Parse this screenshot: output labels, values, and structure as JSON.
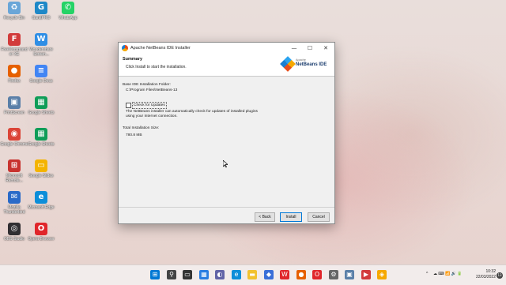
{
  "desktop": {
    "icons": [
      {
        "label": "Recycle Bin",
        "icon": "recycle-bin-icon",
        "color": "#6aa6d8",
        "glyph": "♻"
      },
      {
        "label": "GanttPRO",
        "icon": "ganttpro-icon",
        "color": "#1e88c7",
        "glyph": "G"
      },
      {
        "label": "WhatsApp",
        "icon": "whatsapp-icon",
        "color": "#25d366",
        "glyph": "✆"
      },
      {
        "label": "FreeCommander XE",
        "icon": "freecommander-icon",
        "color": "#d23b3b",
        "glyph": "F"
      },
      {
        "label": "Wondershare Screen...",
        "icon": "wondershare-icon",
        "color": "#2f8ee5",
        "glyph": "W"
      },
      {
        "label": "Firefox",
        "icon": "firefox-icon",
        "color": "#e66000",
        "glyph": "●"
      },
      {
        "label": "Google Docs",
        "icon": "google-docs-icon",
        "color": "#4285f4",
        "glyph": "≡"
      },
      {
        "label": "PrintScreen",
        "icon": "printscreen-icon",
        "color": "#5a7fa8",
        "glyph": "▣"
      },
      {
        "label": "Google Sheets",
        "icon": "google-sheets-icon",
        "color": "#0f9d58",
        "glyph": "▦"
      },
      {
        "label": "Google Chrome",
        "icon": "chrome-icon",
        "color": "#db4437",
        "glyph": "◉"
      },
      {
        "label": "Google Sheets",
        "icon": "google-sheets-icon",
        "color": "#0f9d58",
        "glyph": "▦"
      },
      {
        "label": "Microsoft Remote...",
        "icon": "remote-desktop-icon",
        "color": "#c8332f",
        "glyph": "⊞"
      },
      {
        "label": "Google Slides",
        "icon": "google-slides-icon",
        "color": "#f4b400",
        "glyph": "▭"
      },
      {
        "label": "Mozilla Thunderbird",
        "icon": "thunderbird-icon",
        "color": "#2a6ac8",
        "glyph": "✉"
      },
      {
        "label": "Microsoft Edge",
        "icon": "edge-icon",
        "color": "#0c8ed9",
        "glyph": "e"
      },
      {
        "label": "OBS Studio",
        "icon": "obs-icon",
        "color": "#302e31",
        "glyph": "◎"
      },
      {
        "label": "Opera Browser",
        "icon": "opera-icon",
        "color": "#e0262b",
        "glyph": "O"
      }
    ]
  },
  "window": {
    "title": "Apache NetBeans IDE Installer",
    "minimize": "—",
    "maximize": "☐",
    "close": "✕",
    "header_title": "Summary",
    "header_subtitle": "Click Install to start the installation.",
    "logo_small": "Apache",
    "logo_name": "NetBeans IDE",
    "folder_label": "Base IDE Installation Folder:",
    "folder_value": "C:\\Program Files\\NetBeans-13",
    "checkbox_label": "Check for Updates",
    "checkbox_checked": false,
    "update_note_line1": "The NetBeans installer can automatically check for updates of installed plugins",
    "update_note_line2": "using your Internet connection.",
    "size_label": "Total Installation Size:",
    "size_value": "780.8 MB",
    "back_label": "< Back",
    "install_label": "Install",
    "cancel_label": "Cancel"
  },
  "taskbar": {
    "apps": [
      {
        "icon": "windows-start-icon",
        "color": "#0078d4",
        "glyph": "⊞"
      },
      {
        "icon": "search-icon",
        "color": "#444444",
        "glyph": "⚲"
      },
      {
        "icon": "task-view-icon",
        "color": "#333333",
        "glyph": "▭"
      },
      {
        "icon": "widgets-icon",
        "color": "#2a7de1",
        "glyph": "▦"
      },
      {
        "icon": "chat-icon",
        "color": "#6264a7",
        "glyph": "◐"
      },
      {
        "icon": "edge-icon",
        "color": "#0c8ed9",
        "glyph": "e"
      },
      {
        "icon": "file-explorer-icon",
        "color": "#f2c230",
        "glyph": "▬"
      },
      {
        "icon": "store-icon",
        "color": "#3a6fd8",
        "glyph": "◆"
      },
      {
        "icon": "wps-office-icon",
        "color": "#e0262b",
        "glyph": "W"
      },
      {
        "icon": "firefox-icon",
        "color": "#e66000",
        "glyph": "●"
      },
      {
        "icon": "opera-icon",
        "color": "#e0262b",
        "glyph": "O"
      },
      {
        "icon": "settings-icon",
        "color": "#666666",
        "glyph": "⚙"
      },
      {
        "icon": "printscreen-icon",
        "color": "#5a7fa8",
        "glyph": "▣"
      },
      {
        "icon": "media-icon",
        "color": "#d23b3b",
        "glyph": "▶"
      },
      {
        "icon": "netbeans-icon",
        "color": "#f6a800",
        "glyph": "◈"
      }
    ],
    "tray_chevron": "^",
    "tray_icons": "☁ ⌨ 📶 🔊 🔋",
    "time": "10:32",
    "date": "22/03/2022",
    "notifications": "13"
  }
}
